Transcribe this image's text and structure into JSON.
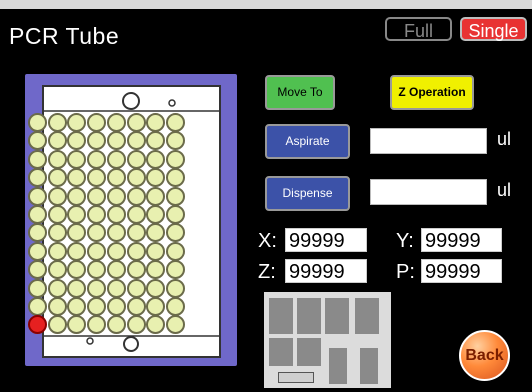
{
  "header": {
    "title": "PCR Tube",
    "toggle_full": "Full",
    "toggle_single": "Single"
  },
  "actions": {
    "move_to": "Move To",
    "z_operation": "Z Operation",
    "aspirate": "Aspirate",
    "dispense": "Dispense",
    "aspirate_value": "",
    "dispense_value": "",
    "unit": "ul"
  },
  "coordinates": {
    "x_label": "X:",
    "y_label": "Y:",
    "z_label": "Z:",
    "p_label": "P:",
    "x_value": "99999",
    "y_value": "99999",
    "z_value": "99999",
    "p_value": "99999"
  },
  "plate": {
    "rows": 12,
    "columns": 8,
    "selected_well": {
      "row": 12,
      "column": 1
    }
  },
  "colors": {
    "plate_panel": "#6f68c9",
    "well": "#e8f0b0",
    "selected_well": "#e62020",
    "move_to": "#50c050",
    "z_operation": "#f0f000",
    "aspirate_dispense": "#3c52a8",
    "single_active": "#e83232"
  },
  "footer": {
    "back": "Back"
  }
}
